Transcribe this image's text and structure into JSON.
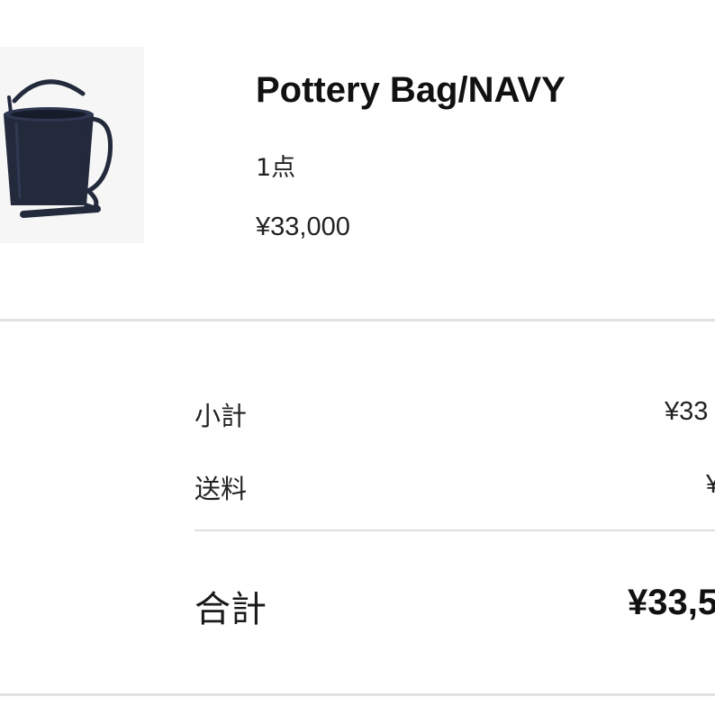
{
  "product": {
    "image_name": "navy-bucket-bag-image",
    "name": "Pottery Bag/NAVY",
    "quantity": "1点",
    "price": "¥33,000"
  },
  "summary": {
    "subtotal_label": "小計",
    "subtotal_value": "¥33",
    "shipping_label": "送料",
    "shipping_value": "¥",
    "total_label": "合計",
    "total_value": "¥33,5"
  },
  "colors": {
    "bag": "#232a3c",
    "divider": "#e2e2e2",
    "text": "#1c1c1c"
  }
}
